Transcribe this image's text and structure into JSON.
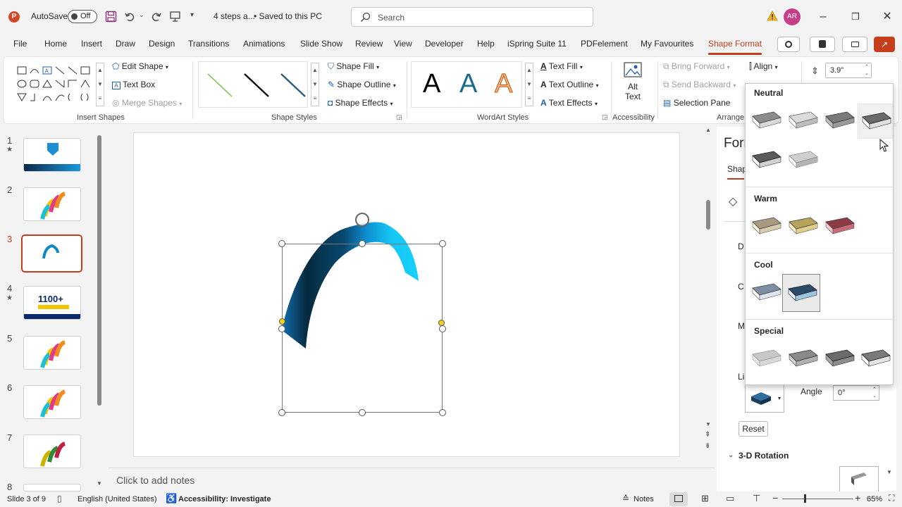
{
  "titlebar": {
    "autosave_label": "AutoSave",
    "autosave_state": "Off",
    "doc_name": "4 steps a...",
    "save_status": "• Saved to this PC",
    "search_placeholder": "Search",
    "avatar_initials": "AR"
  },
  "tabs": [
    "File",
    "Home",
    "Insert",
    "Draw",
    "Design",
    "Transitions",
    "Animations",
    "Slide Show",
    "Review",
    "View",
    "Developer",
    "Help",
    "iSpring Suite 11",
    "PDFelement",
    "My Favourites",
    "Shape Format"
  ],
  "active_tab": "Shape Format",
  "ribbon": {
    "insert_shapes": {
      "edit_shape": "Edit Shape",
      "text_box": "Text Box",
      "merge_shapes": "Merge Shapes",
      "group_label": "Insert Shapes"
    },
    "shape_styles": {
      "shape_fill": "Shape Fill",
      "shape_outline": "Shape Outline",
      "shape_effects": "Shape Effects",
      "group_label": "Shape Styles"
    },
    "wordart": {
      "letter": "A",
      "text_fill": "Text Fill",
      "text_outline": "Text Outline",
      "text_effects": "Text Effects",
      "group_label": "WordArt Styles"
    },
    "accessibility": {
      "alt_text_line1": "Alt",
      "alt_text_line2": "Text",
      "group_label": "Accessibility"
    },
    "arrange": {
      "bring_forward": "Bring Forward",
      "send_backward": "Send Backward",
      "selection_pane": "Selection Pane",
      "align": "Align",
      "group_label": "Arrange"
    },
    "size": {
      "height_value": "3.9\""
    }
  },
  "slides": [
    {
      "num": "1",
      "star": true
    },
    {
      "num": "2",
      "star": false
    },
    {
      "num": "3",
      "star": false
    },
    {
      "num": "4",
      "star": true,
      "thumb_text": "1100+"
    },
    {
      "num": "5",
      "star": false
    },
    {
      "num": "6",
      "star": false
    },
    {
      "num": "7",
      "star": false
    },
    {
      "num": "8",
      "star": false
    }
  ],
  "current_slide": "3",
  "notes_placeholder": "Click to add notes",
  "panel": {
    "title": "Form",
    "tab": "Shap",
    "angle_label": "Angle",
    "angle_value": "0°",
    "reset_label": "Reset",
    "rotation_header": "3-D Rotation",
    "frag_d": "D",
    "frag_c": "C",
    "frag_m": "M",
    "frag_li": "Li"
  },
  "bevel_dropdown": {
    "sections": [
      {
        "title": "Neutral",
        "count": 6
      },
      {
        "title": "Warm",
        "count": 3
      },
      {
        "title": "Cool",
        "count": 2
      },
      {
        "title": "Special",
        "count": 4
      }
    ]
  },
  "status": {
    "slide_info": "Slide 3 of 9",
    "language": "English (United States)",
    "accessibility": "Accessibility: Investigate",
    "notes": "Notes",
    "zoom": "65%"
  },
  "colors": {
    "accent": "#c43e1c",
    "shape_dark": "#062a3f",
    "shape_light": "#16c7f5"
  }
}
